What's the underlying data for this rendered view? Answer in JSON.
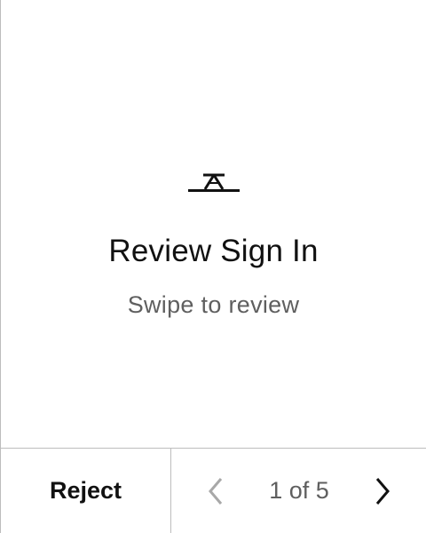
{
  "screen": {
    "title": "Review Sign In",
    "subtitle": "Swipe to review",
    "logo_icon": "triangle-logo-icon"
  },
  "footer": {
    "reject_label": "Reject",
    "pagination": {
      "text": "1 of 5",
      "current": 1,
      "total": 5,
      "prev_icon": "chevron-left-icon",
      "next_icon": "chevron-right-icon",
      "prev_enabled": false,
      "next_enabled": true
    }
  },
  "colors": {
    "text_primary": "#111111",
    "text_secondary": "#5f5f5f",
    "divider": "#bdbdbd",
    "disabled_icon": "#a8a8a8"
  }
}
